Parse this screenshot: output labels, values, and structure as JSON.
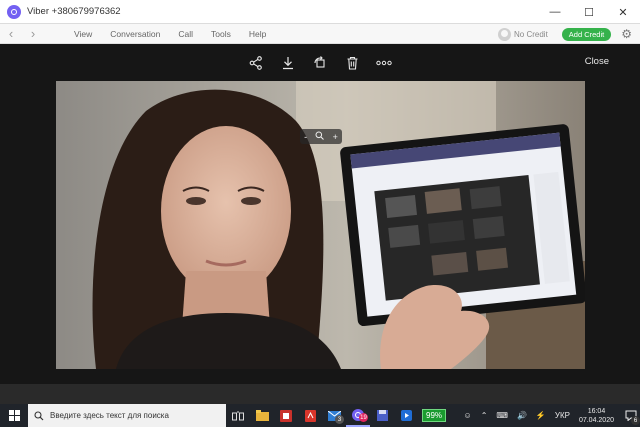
{
  "window": {
    "title": "Viber +380679976362",
    "minimize_glyph": "—",
    "maximize_glyph": "☐",
    "close_glyph": "✕"
  },
  "menubar": {
    "items": [
      "View",
      "Conversation",
      "Call",
      "Tools",
      "Help"
    ],
    "credit_text": "No Credit",
    "add_credit_label": "Add Credit"
  },
  "viewer": {
    "close_label": "Close",
    "zoom_minus": "-",
    "zoom_plus": "+"
  },
  "taskbar": {
    "search_placeholder": "Введите здесь текст для поиска",
    "badge_mail": "3",
    "badge_viber": "19",
    "battery_label": "99%",
    "language": "УКР",
    "time": "16:04",
    "date": "07.04.2020",
    "notification_count": "6"
  },
  "colors": {
    "viber_purple": "#7360f2",
    "add_credit_green": "#35b24b",
    "taskbar_bg": "#20242a"
  }
}
